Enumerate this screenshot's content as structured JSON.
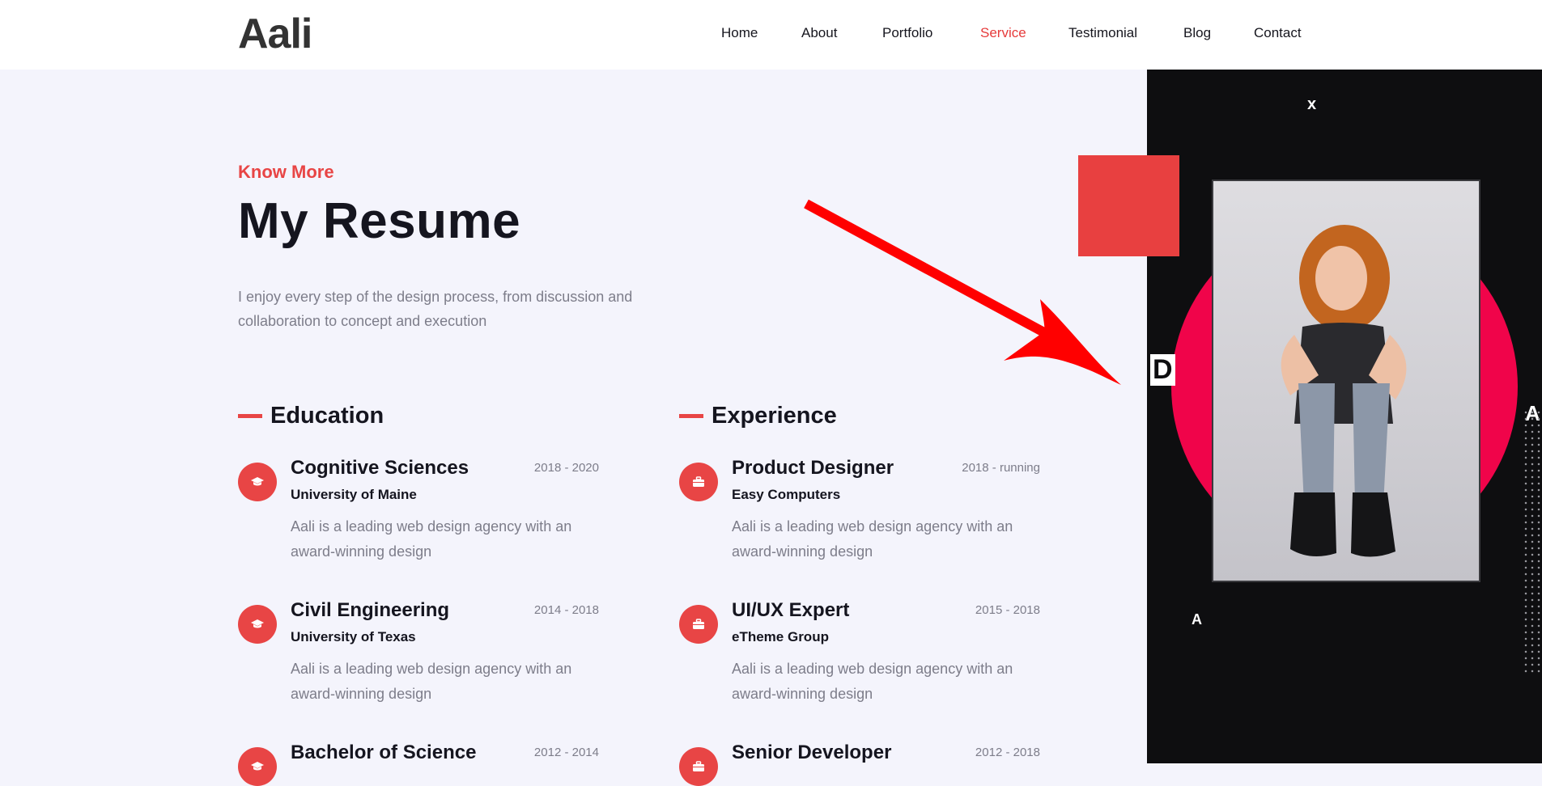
{
  "brand": {
    "logo": "Aali",
    "accent_color": "#e84545"
  },
  "nav": {
    "items": [
      {
        "label": "Home",
        "active": false
      },
      {
        "label": "About",
        "active": false
      },
      {
        "label": "Portfolio",
        "active": false
      },
      {
        "label": "Service",
        "active": true
      },
      {
        "label": "Testimonial",
        "active": false
      },
      {
        "label": "Blog",
        "active": false
      },
      {
        "label": "Contact",
        "active": false
      }
    ]
  },
  "resume": {
    "eyebrow": "Know More",
    "title": "My Resume",
    "intro": "I enjoy every step of the design process, from discussion and collaboration to concept and execution"
  },
  "education": {
    "heading": "Education",
    "icon": "graduation-cap-icon",
    "items": [
      {
        "name": "Cognitive Sciences",
        "years": "2018 - 2020",
        "org": "University of Maine",
        "desc": "Aali is a leading web design agency with an award-winning design"
      },
      {
        "name": "Civil Engineering",
        "years": "2014 - 2018",
        "org": "University of Texas",
        "desc": "Aali is a leading web design agency with an award-winning design"
      },
      {
        "name": "Bachelor of Science",
        "years": "2012 - 2014",
        "org": "",
        "desc": ""
      }
    ]
  },
  "experience": {
    "heading": "Experience",
    "icon": "briefcase-icon",
    "items": [
      {
        "name": "Product Designer",
        "years": "2018 - running",
        "org": "Easy Computers",
        "desc": "Aali is a leading web design agency with an award-winning design"
      },
      {
        "name": "UI/UX Expert",
        "years": "2015 - 2018",
        "org": "eTheme Group",
        "desc": "Aali is a leading web design agency with an award-winning design"
      },
      {
        "name": "Senior Developer",
        "years": "2012 - 2018",
        "org": "",
        "desc": ""
      }
    ]
  },
  "panel": {
    "close_label": "x",
    "letters": [
      "D",
      "A",
      "A"
    ]
  }
}
